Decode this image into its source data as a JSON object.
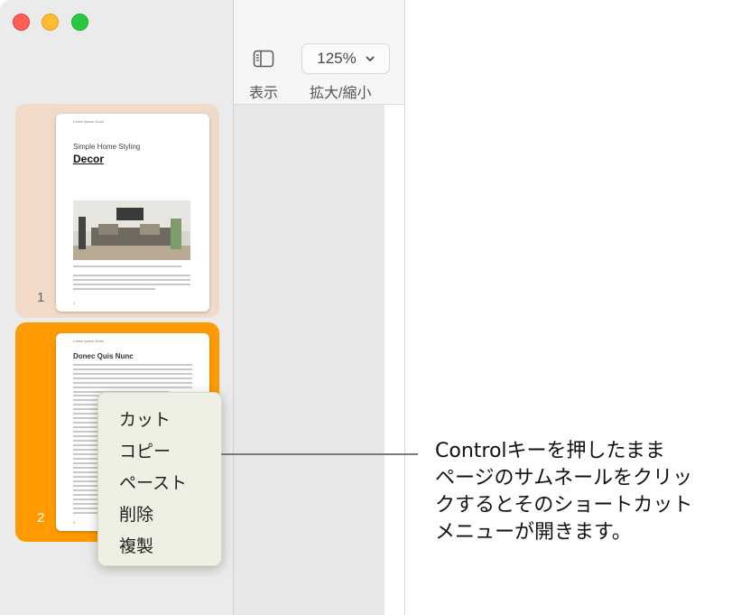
{
  "toolbar": {
    "view_label": "表示",
    "zoom_value": "125%",
    "zoom_label": "拡大/縮小"
  },
  "thumbnails": [
    {
      "number": "1",
      "header": "Lorem Ipsum Dolor",
      "subtitle": "Simple Home Styling",
      "title": "Decor",
      "footer_num": "1"
    },
    {
      "number": "2",
      "header": "Lorem Ipsum Dolor",
      "title": "Donec Quis Nunc",
      "footer_num": "2"
    }
  ],
  "context_menu": {
    "items": [
      "カット",
      "コピー",
      "ペースト",
      "削除",
      "複製"
    ]
  },
  "callout": {
    "lines": [
      "Controlキーを押したまま",
      "ページのサムネールをクリッ",
      "クするとそのショートカット",
      "メニューが開きます。"
    ]
  },
  "colors": {
    "selected_thumb": "#ff9b00",
    "unselected_thumb": "#f1dbc8",
    "menu_bg": "#f0efe4"
  }
}
